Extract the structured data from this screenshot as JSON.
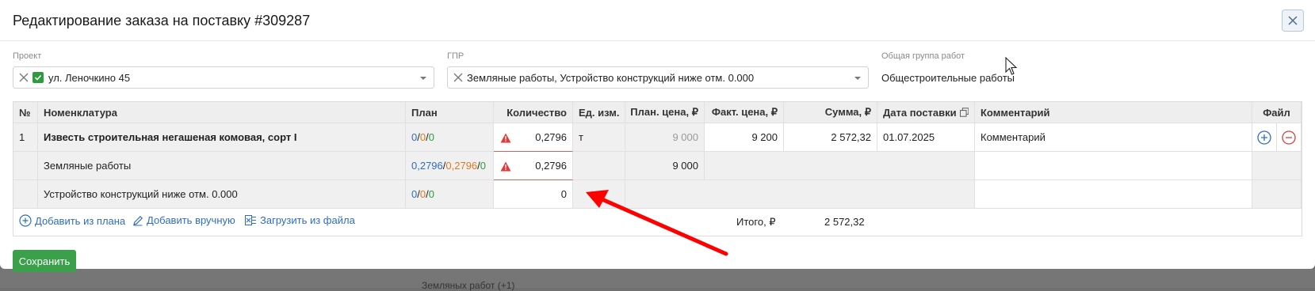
{
  "backdrop": {
    "text": "Земляных работ (+1)"
  },
  "modal": {
    "title": "Редактирование заказа на поставку #309287"
  },
  "filters": {
    "project": {
      "label": "Проект",
      "value": "ул. Леночкино 45"
    },
    "gpr": {
      "label": "ГПР",
      "value": "Земляные работы, Устройство конструкций ниже отм. 0.000"
    },
    "work_group": {
      "label": "Общая группа работ",
      "value": "Общестроительные работы"
    }
  },
  "table": {
    "headers": {
      "num": "№",
      "nomenclature": "Номенклатура",
      "plan": "План",
      "quantity": "Количество",
      "unit": "Ед. изм.",
      "plan_price": "План. цена, ₽",
      "fact_price": "Факт. цена, ₽",
      "sum": "Сумма, ₽",
      "delivery_date": "Дата поставки",
      "comment": "Комментарий",
      "file": "Файл"
    },
    "rows": [
      {
        "num": "1",
        "name": "Известь строительная негашеная комовая, сорт I",
        "plan": [
          "0",
          "0",
          "0"
        ],
        "quantity": "0,2796",
        "unit": "т",
        "plan_price": "9 000",
        "fact_price": "9 200",
        "sum": "2 572,32",
        "delivery_date": "01.07.2025",
        "comment": "Комментарий"
      },
      {
        "name": "Земляные работы",
        "plan": [
          "0,2796",
          "0,2796",
          "0"
        ],
        "quantity": "0,2796",
        "plan_price": "9 000"
      },
      {
        "name": "Устройство конструкций ниже отм. 0.000",
        "plan": [
          "0",
          "0",
          "0"
        ],
        "quantity": "0"
      }
    ],
    "plan_separator": "/"
  },
  "footer": {
    "add_from_plan": "Добавить из плана",
    "add_manual": "Добавить вручную",
    "upload_file": "Загрузить из файла",
    "total_label": "Итого, ₽",
    "total_value": "2 572,32"
  },
  "actions": {
    "save": "Сохранить"
  },
  "colors": {
    "accent_blue": "#2f6dbf",
    "plan_orange": "#e07a1f",
    "plan_green": "#2e9b3e",
    "save_green": "#3aa04a",
    "warning_red": "#e03a3a",
    "annotation_arrow": "#ff0000"
  }
}
